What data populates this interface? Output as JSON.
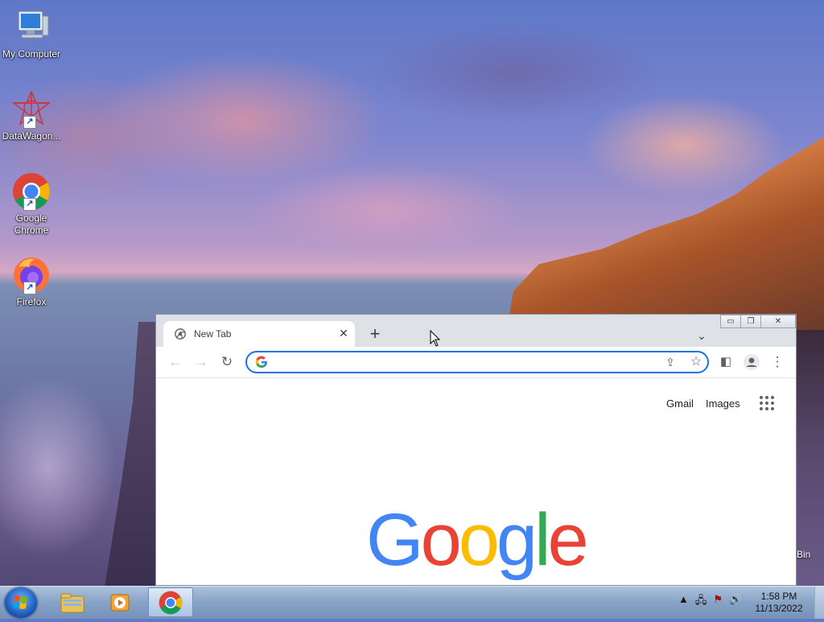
{
  "desktop": {
    "icons": [
      {
        "label": "My Computer"
      },
      {
        "label": "DataWagon..."
      },
      {
        "label": "Google Chrome"
      },
      {
        "label": "Firefox"
      }
    ],
    "recycle_bin_partial_label": "Bin"
  },
  "browser": {
    "tab": {
      "title": "New Tab",
      "close_glyph": "✕"
    },
    "new_tab_glyph": "+",
    "tab_search_glyph": "⌄",
    "window_controls": {
      "minimize": "▭",
      "restore": "❐",
      "close": "✕"
    },
    "toolbar": {
      "back": "←",
      "forward": "→",
      "reload": "↻",
      "side_panel": "◧",
      "menu": "⋮"
    },
    "omnibox": {
      "value": "",
      "placeholder": ""
    },
    "links": {
      "gmail": "Gmail",
      "images": "Images"
    },
    "logo": {
      "letters": [
        "G",
        "o",
        "o",
        "g",
        "l",
        "e"
      ],
      "colors": [
        "#4285F4",
        "#EA4335",
        "#FBBC05",
        "#4285F4",
        "#34A853",
        "#EA4335"
      ]
    }
  },
  "taskbar": {
    "clock_time": "1:58 PM",
    "clock_date": "11/13/2022",
    "tray_icons": [
      "show-hidden-icon",
      "network-icon",
      "action-center-icon",
      "volume-icon"
    ]
  }
}
